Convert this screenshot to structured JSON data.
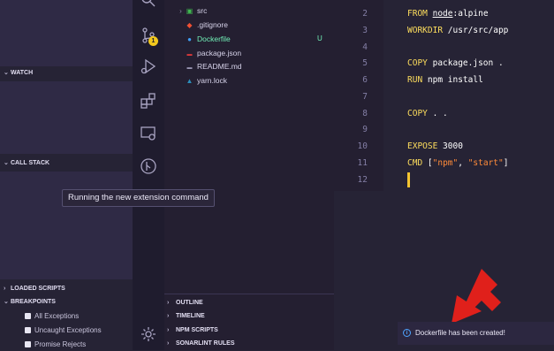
{
  "debug": {
    "watch_label": "WATCH",
    "call_stack_label": "CALL STACK",
    "loaded_scripts_label": "LOADED SCRIPTS",
    "breakpoints_label": "BREAKPOINTS",
    "breakpoints": [
      "All Exceptions",
      "Uncaught Exceptions",
      "Promise Rejects"
    ]
  },
  "activity": {
    "scm_badge": "1",
    "icons": [
      "source-control-icon",
      "run-debug-icon",
      "extensions-icon",
      "remote-explorer-icon",
      "gitlens-icon",
      "settings-gear-icon"
    ]
  },
  "explorer": {
    "files": [
      {
        "name": "src",
        "icon": "folder-icon"
      },
      {
        "name": ".gitignore",
        "icon": "git-icon"
      },
      {
        "name": "Dockerfile",
        "icon": "docker-icon"
      },
      {
        "name": "package.json",
        "icon": "npm-icon"
      },
      {
        "name": "README.md",
        "icon": "markdown-icon"
      },
      {
        "name": "yarn.lock",
        "icon": "yarn-icon"
      }
    ],
    "dockerfile_status": "U",
    "panels": [
      "OUTLINE",
      "TIMELINE",
      "NPM SCRIPTS",
      "SONARLINT RULES"
    ]
  },
  "editor": {
    "line_numbers": [
      "2",
      "3",
      "4",
      "5",
      "6",
      "7",
      "8",
      "9",
      "10",
      "11",
      "12"
    ],
    "l2_kw": "FROM ",
    "l2_img": "node",
    "l2_rest": ":alpine",
    "l3_kw": "WORKDIR ",
    "l3_rest": "/usr/src/app",
    "l5_kw": "COPY ",
    "l5_rest": "package.json .",
    "l6_kw": "RUN ",
    "l6_rest": "npm install",
    "l8_kw": "COPY ",
    "l8_rest": ". .",
    "l10_kw": "EXPOSE ",
    "l10_num": "3000",
    "l11_kw": "CMD ",
    "l11_b1": "[",
    "l11_s1": "\"npm\"",
    "l11_c": ", ",
    "l11_s2": "\"start\"",
    "l11_b2": "]"
  },
  "tooltip": "Running the new extension command",
  "notification": {
    "text": "Dockerfile has been created!",
    "icon": "info-icon"
  },
  "colors": {
    "accent_arrow": "#e0201b",
    "badge": "#f2c81d",
    "keyword": "#fede5d",
    "string": "#ff8b39",
    "untracked": "#72f1b8"
  }
}
